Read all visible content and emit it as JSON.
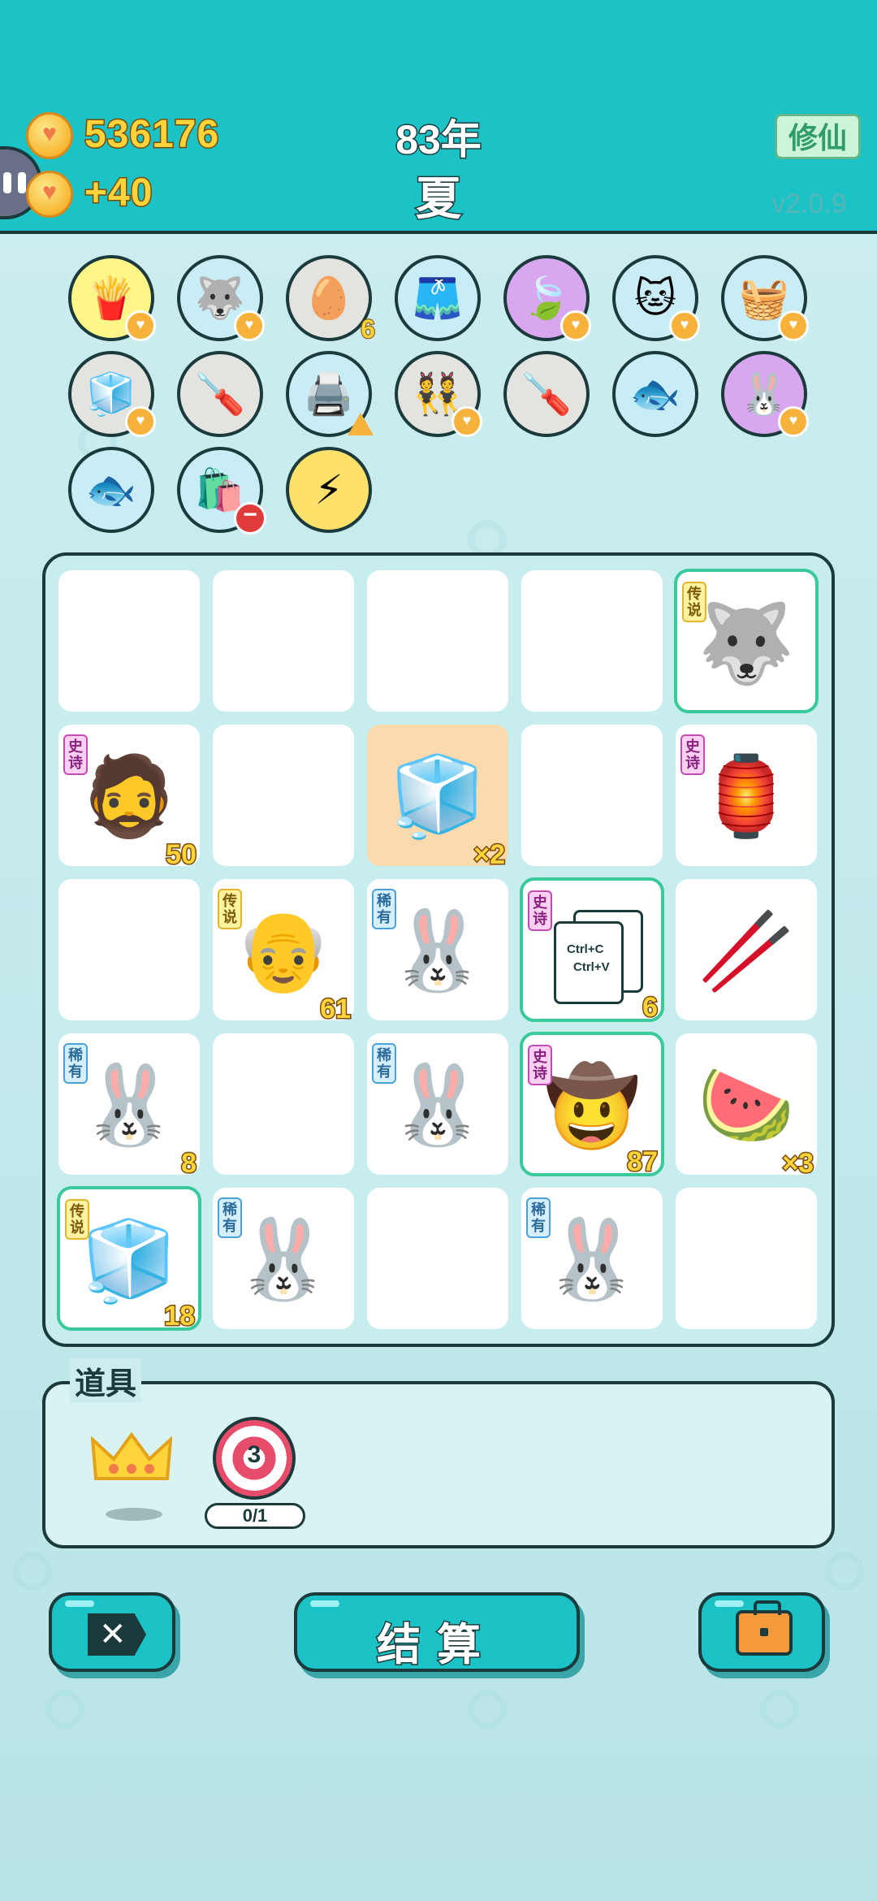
{
  "header": {
    "coins": "536176",
    "income": "+40",
    "year": "83年",
    "season": "夏",
    "xiuxian_label": "修仙",
    "version": "v2.0.9"
  },
  "inventory": [
    {
      "icon": "fries",
      "glyph": "🍟",
      "bg": "#fff68a",
      "badge": "♥"
    },
    {
      "icon": "husky-dog",
      "glyph": "🐺",
      "bg": "#c8edf7",
      "badge": "♥"
    },
    {
      "icon": "egg-tray",
      "glyph": "🥚",
      "bg": "#e3e3df",
      "count": "6"
    },
    {
      "icon": "skirt",
      "glyph": "🩳",
      "bg": "#c8edf7"
    },
    {
      "icon": "leaf",
      "glyph": "🍃",
      "bg": "#d9a6f0",
      "badge": "♥"
    },
    {
      "icon": "cat",
      "glyph": "🐱",
      "bg": "#c8edf7",
      "badge": "♥"
    },
    {
      "icon": "fruit-basket",
      "glyph": "🧺",
      "bg": "#c8edf7",
      "badge": "♥"
    },
    {
      "icon": "sugar-cubes",
      "glyph": "🧊",
      "bg": "#e3e3df",
      "badge": "♥"
    },
    {
      "icon": "screwdriver",
      "glyph": "🪛",
      "bg": "#e3e3df"
    },
    {
      "icon": "printer",
      "glyph": "🖨️",
      "bg": "#c8edf7",
      "warn": true
    },
    {
      "icon": "dancers",
      "glyph": "👯",
      "bg": "#e3e3df",
      "badge": "♥"
    },
    {
      "icon": "screwdriver",
      "glyph": "🪛",
      "bg": "#e3e3df"
    },
    {
      "icon": "fish-bowl",
      "glyph": "🐟",
      "bg": "#c8edf7"
    },
    {
      "icon": "rabbit",
      "glyph": "🐰",
      "bg": "#d9a6f0",
      "badge": "♥"
    },
    {
      "icon": "fish-bowl",
      "glyph": "🐟",
      "bg": "#c8edf7"
    },
    {
      "icon": "trash-bag",
      "glyph": "🛍️",
      "bg": "#c8edf7",
      "minus": true
    },
    {
      "icon": "lightning",
      "glyph": "⚡",
      "bg": "#fde16a"
    }
  ],
  "board": [
    {
      "row": 0,
      "col": 0
    },
    {
      "row": 0,
      "col": 1
    },
    {
      "row": 0,
      "col": 2
    },
    {
      "row": 0,
      "col": 3
    },
    {
      "row": 0,
      "col": 4,
      "glyph": "🐺",
      "tag": "传说",
      "tagType": "legend",
      "hl": true,
      "name": "husky-king"
    },
    {
      "row": 1,
      "col": 0,
      "glyph": "🧔",
      "tag": "史诗",
      "tagType": "epic",
      "count": "50",
      "name": "bearded-man"
    },
    {
      "row": 1,
      "col": 1
    },
    {
      "row": 1,
      "col": 2,
      "glyph": "🧊",
      "count": "×2",
      "orange": true,
      "name": "fridge"
    },
    {
      "row": 1,
      "col": 3
    },
    {
      "row": 1,
      "col": 4,
      "glyph": "🏮",
      "tag": "史诗",
      "tagType": "epic",
      "name": "rabbit-house"
    },
    {
      "row": 2,
      "col": 0
    },
    {
      "row": 2,
      "col": 1,
      "glyph": "👴",
      "tag": "传说",
      "tagType": "legend",
      "count": "61",
      "name": "old-man"
    },
    {
      "row": 2,
      "col": 2,
      "glyph": "🐰",
      "tag": "稀有",
      "tagType": "rare",
      "name": "rabbit"
    },
    {
      "row": 2,
      "col": 3,
      "ctrl": true,
      "tag": "史诗",
      "tagType": "epic",
      "count": "6",
      "hl": true,
      "name": "ctrl-c-v"
    },
    {
      "row": 2,
      "col": 4,
      "glyph": "🥢",
      "name": "straw"
    },
    {
      "row": 3,
      "col": 0,
      "glyph": "🐰",
      "tag": "稀有",
      "tagType": "rare",
      "count": "8",
      "name": "rabbit"
    },
    {
      "row": 3,
      "col": 1
    },
    {
      "row": 3,
      "col": 2,
      "glyph": "🐰",
      "tag": "稀有",
      "tagType": "rare",
      "name": "rabbit"
    },
    {
      "row": 3,
      "col": 3,
      "glyph": "🤠",
      "tag": "史诗",
      "tagType": "epic",
      "count": "87",
      "hl": true,
      "name": "cowboy"
    },
    {
      "row": 3,
      "col": 4,
      "glyph": "🍉",
      "count": "×3",
      "name": "watermelon"
    },
    {
      "row": 4,
      "col": 0,
      "glyph": "🧊",
      "tag": "传说",
      "tagType": "legend",
      "count": "18",
      "hl": true,
      "name": "fridge"
    },
    {
      "row": 4,
      "col": 1,
      "glyph": "🐰",
      "tag": "稀有",
      "tagType": "rare",
      "name": "rabbit"
    },
    {
      "row": 4,
      "col": 2
    },
    {
      "row": 4,
      "col": 3,
      "glyph": "🐰",
      "tag": "稀有",
      "tagType": "rare",
      "name": "rabbit"
    },
    {
      "row": 4,
      "col": 4
    }
  ],
  "ctrl_text": [
    "Ctrl+C",
    "Ctrl+V"
  ],
  "props": {
    "title": "道具",
    "target_count": "3",
    "target_progress": "0/1"
  },
  "buttons": {
    "settle": "结算",
    "close_glyph": "✕"
  },
  "colors": {
    "header": "#1cc3c6",
    "outline": "#1b3a3b",
    "gold": "#ffd33a"
  }
}
